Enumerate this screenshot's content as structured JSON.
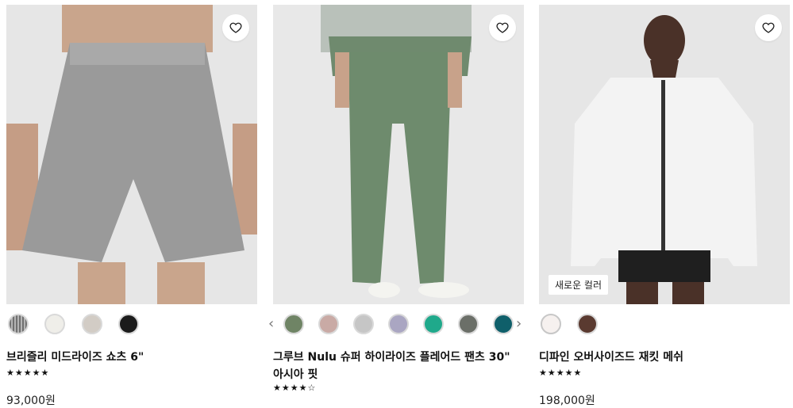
{
  "products": [
    {
      "name": "브리즐리 미드라이즈 쇼츠 6\"",
      "rating_stars": "★★★★★",
      "price": "93,000원",
      "badge": "",
      "swatches": [
        "#8b8b8b",
        "#efeee9",
        "#d2ccc5",
        "#1b1b1b"
      ]
    },
    {
      "name": "그루브 Nulu 슈퍼 하이라이즈 플레어드 팬츠 30\" 아시아 핏",
      "rating_stars": "★★★★☆",
      "price": "",
      "badge": "",
      "swatches": [
        "#6f8465",
        "#c9aaa5",
        "#c6c6c6",
        "#aaa6c2",
        "#1fa98b",
        "#6b6f68",
        "#0f5f6a"
      ]
    },
    {
      "name": "디파인 오버사이즈드 재킷 메쉬",
      "rating_stars": "★★★★★",
      "price": "198,000원",
      "badge": "새로운 컬러",
      "swatches": [
        "#f6f1ef",
        "#5a3a30"
      ]
    }
  ],
  "nav": {
    "prev": "‹",
    "next": "›"
  }
}
